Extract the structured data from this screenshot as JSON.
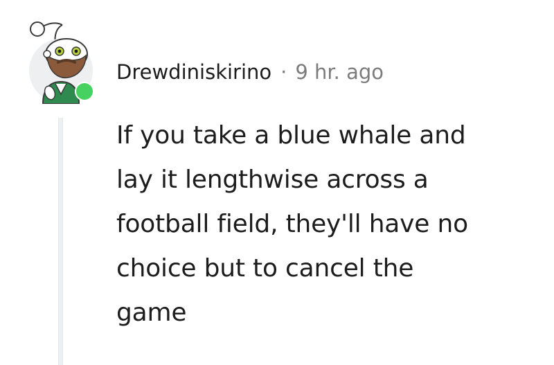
{
  "comment": {
    "author": "Drewdiniskirino",
    "separator": "·",
    "timestamp": "9 hr. ago",
    "body_lines": [
      "If you take a blue whale and",
      "lay it lengthwise across a",
      "football field, they'll have no",
      "choice but to cancel the",
      "game"
    ],
    "avatar_icon": "snoo-avatar-icon",
    "online_status_color": "#46d160"
  }
}
